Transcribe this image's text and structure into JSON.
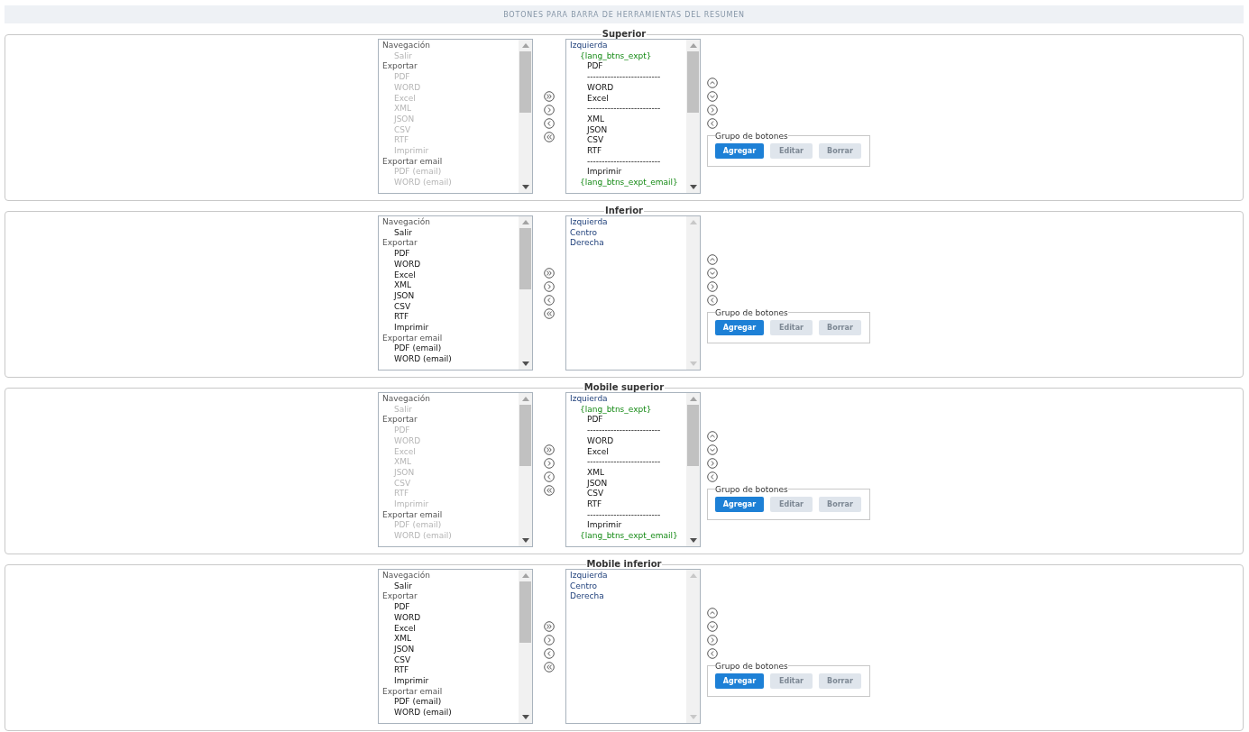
{
  "header": {
    "title": "BOTONES PARA BARRA DE HERRAMIENTAS DEL RESUMEN"
  },
  "sections": [
    {
      "title": "Superior",
      "available": [
        {
          "label": "Navegación",
          "disabled": false,
          "children": [
            {
              "label": "Salir",
              "disabled": true
            }
          ]
        },
        {
          "label": "Exportar",
          "disabled": false,
          "children": [
            {
              "label": "PDF",
              "disabled": true
            },
            {
              "label": "WORD",
              "disabled": true
            },
            {
              "label": "Excel",
              "disabled": true
            },
            {
              "label": "XML",
              "disabled": true
            },
            {
              "label": "JSON",
              "disabled": true
            },
            {
              "label": "CSV",
              "disabled": true
            },
            {
              "label": "RTF",
              "disabled": true
            },
            {
              "label": "Imprimir",
              "disabled": true
            }
          ]
        },
        {
          "label": "Exportar email",
          "disabled": false,
          "children": [
            {
              "label": "PDF (email)",
              "disabled": true
            },
            {
              "label": "WORD (email)",
              "disabled": true
            }
          ]
        }
      ],
      "chosen": [
        {
          "kind": "position",
          "label": "Izquierda"
        },
        {
          "kind": "group",
          "label": "{lang_btns_expt}"
        },
        {
          "kind": "button",
          "label": "PDF"
        },
        {
          "kind": "separator",
          "label": "-------------------------"
        },
        {
          "kind": "button",
          "label": "WORD"
        },
        {
          "kind": "button",
          "label": "Excel"
        },
        {
          "kind": "separator",
          "label": "-------------------------"
        },
        {
          "kind": "button",
          "label": "XML"
        },
        {
          "kind": "button",
          "label": "JSON"
        },
        {
          "kind": "button",
          "label": "CSV"
        },
        {
          "kind": "button",
          "label": "RTF"
        },
        {
          "kind": "separator",
          "label": "-------------------------"
        },
        {
          "kind": "button",
          "label": "Imprimir"
        },
        {
          "kind": "group",
          "label": "{lang_btns_expt_email}"
        }
      ],
      "group_box": {
        "title": "Grupo de botones",
        "buttons": [
          {
            "label": "Agregar",
            "disabled": false
          },
          {
            "label": "Editar",
            "disabled": true
          },
          {
            "label": "Borrar",
            "disabled": true
          }
        ]
      }
    },
    {
      "title": "Inferior",
      "available": [
        {
          "label": "Navegación",
          "disabled": false,
          "children": [
            {
              "label": "Salir",
              "disabled": false
            }
          ]
        },
        {
          "label": "Exportar",
          "disabled": false,
          "children": [
            {
              "label": "PDF",
              "disabled": false
            },
            {
              "label": "WORD",
              "disabled": false
            },
            {
              "label": "Excel",
              "disabled": false
            },
            {
              "label": "XML",
              "disabled": false
            },
            {
              "label": "JSON",
              "disabled": false
            },
            {
              "label": "CSV",
              "disabled": false
            },
            {
              "label": "RTF",
              "disabled": false
            },
            {
              "label": "Imprimir",
              "disabled": false
            }
          ]
        },
        {
          "label": "Exportar email",
          "disabled": false,
          "children": [
            {
              "label": "PDF (email)",
              "disabled": false
            },
            {
              "label": "WORD (email)",
              "disabled": false
            }
          ]
        }
      ],
      "chosen": [
        {
          "kind": "position",
          "label": "Izquierda"
        },
        {
          "kind": "position",
          "label": "Centro"
        },
        {
          "kind": "position",
          "label": "Derecha"
        }
      ],
      "group_box": {
        "title": "Grupo de botones",
        "buttons": [
          {
            "label": "Agregar",
            "disabled": false
          },
          {
            "label": "Editar",
            "disabled": true
          },
          {
            "label": "Borrar",
            "disabled": true
          }
        ]
      }
    },
    {
      "title": "Mobile superior",
      "available": [
        {
          "label": "Navegación",
          "disabled": false,
          "children": [
            {
              "label": "Salir",
              "disabled": true
            }
          ]
        },
        {
          "label": "Exportar",
          "disabled": false,
          "children": [
            {
              "label": "PDF",
              "disabled": true
            },
            {
              "label": "WORD",
              "disabled": true
            },
            {
              "label": "Excel",
              "disabled": true
            },
            {
              "label": "XML",
              "disabled": true
            },
            {
              "label": "JSON",
              "disabled": true
            },
            {
              "label": "CSV",
              "disabled": true
            },
            {
              "label": "RTF",
              "disabled": true
            },
            {
              "label": "Imprimir",
              "disabled": true
            }
          ]
        },
        {
          "label": "Exportar email",
          "disabled": false,
          "children": [
            {
              "label": "PDF (email)",
              "disabled": true
            },
            {
              "label": "WORD (email)",
              "disabled": true
            }
          ]
        }
      ],
      "chosen": [
        {
          "kind": "position",
          "label": "Izquierda"
        },
        {
          "kind": "group",
          "label": "{lang_btns_expt}"
        },
        {
          "kind": "button",
          "label": "PDF"
        },
        {
          "kind": "separator",
          "label": "-------------------------"
        },
        {
          "kind": "button",
          "label": "WORD"
        },
        {
          "kind": "button",
          "label": "Excel"
        },
        {
          "kind": "separator",
          "label": "-------------------------"
        },
        {
          "kind": "button",
          "label": "XML"
        },
        {
          "kind": "button",
          "label": "JSON"
        },
        {
          "kind": "button",
          "label": "CSV"
        },
        {
          "kind": "button",
          "label": "RTF"
        },
        {
          "kind": "separator",
          "label": "-------------------------"
        },
        {
          "kind": "button",
          "label": "Imprimir"
        },
        {
          "kind": "group",
          "label": "{lang_btns_expt_email}"
        }
      ],
      "group_box": {
        "title": "Grupo de botones",
        "buttons": [
          {
            "label": "Agregar",
            "disabled": false
          },
          {
            "label": "Editar",
            "disabled": true
          },
          {
            "label": "Borrar",
            "disabled": true
          }
        ]
      }
    },
    {
      "title": "Mobile inferior",
      "available": [
        {
          "label": "Navegación",
          "disabled": false,
          "children": [
            {
              "label": "Salir",
              "disabled": false
            }
          ]
        },
        {
          "label": "Exportar",
          "disabled": false,
          "children": [
            {
              "label": "PDF",
              "disabled": false
            },
            {
              "label": "WORD",
              "disabled": false
            },
            {
              "label": "Excel",
              "disabled": false
            },
            {
              "label": "XML",
              "disabled": false
            },
            {
              "label": "JSON",
              "disabled": false
            },
            {
              "label": "CSV",
              "disabled": false
            },
            {
              "label": "RTF",
              "disabled": false
            },
            {
              "label": "Imprimir",
              "disabled": false
            }
          ]
        },
        {
          "label": "Exportar email",
          "disabled": false,
          "children": [
            {
              "label": "PDF (email)",
              "disabled": false
            },
            {
              "label": "WORD (email)",
              "disabled": false
            }
          ]
        }
      ],
      "chosen": [
        {
          "kind": "position",
          "label": "Izquierda"
        },
        {
          "kind": "position",
          "label": "Centro"
        },
        {
          "kind": "position",
          "label": "Derecha"
        }
      ],
      "group_box": {
        "title": "Grupo de botones",
        "buttons": [
          {
            "label": "Agregar",
            "disabled": false
          },
          {
            "label": "Editar",
            "disabled": true
          },
          {
            "label": "Borrar",
            "disabled": true
          }
        ]
      }
    }
  ]
}
